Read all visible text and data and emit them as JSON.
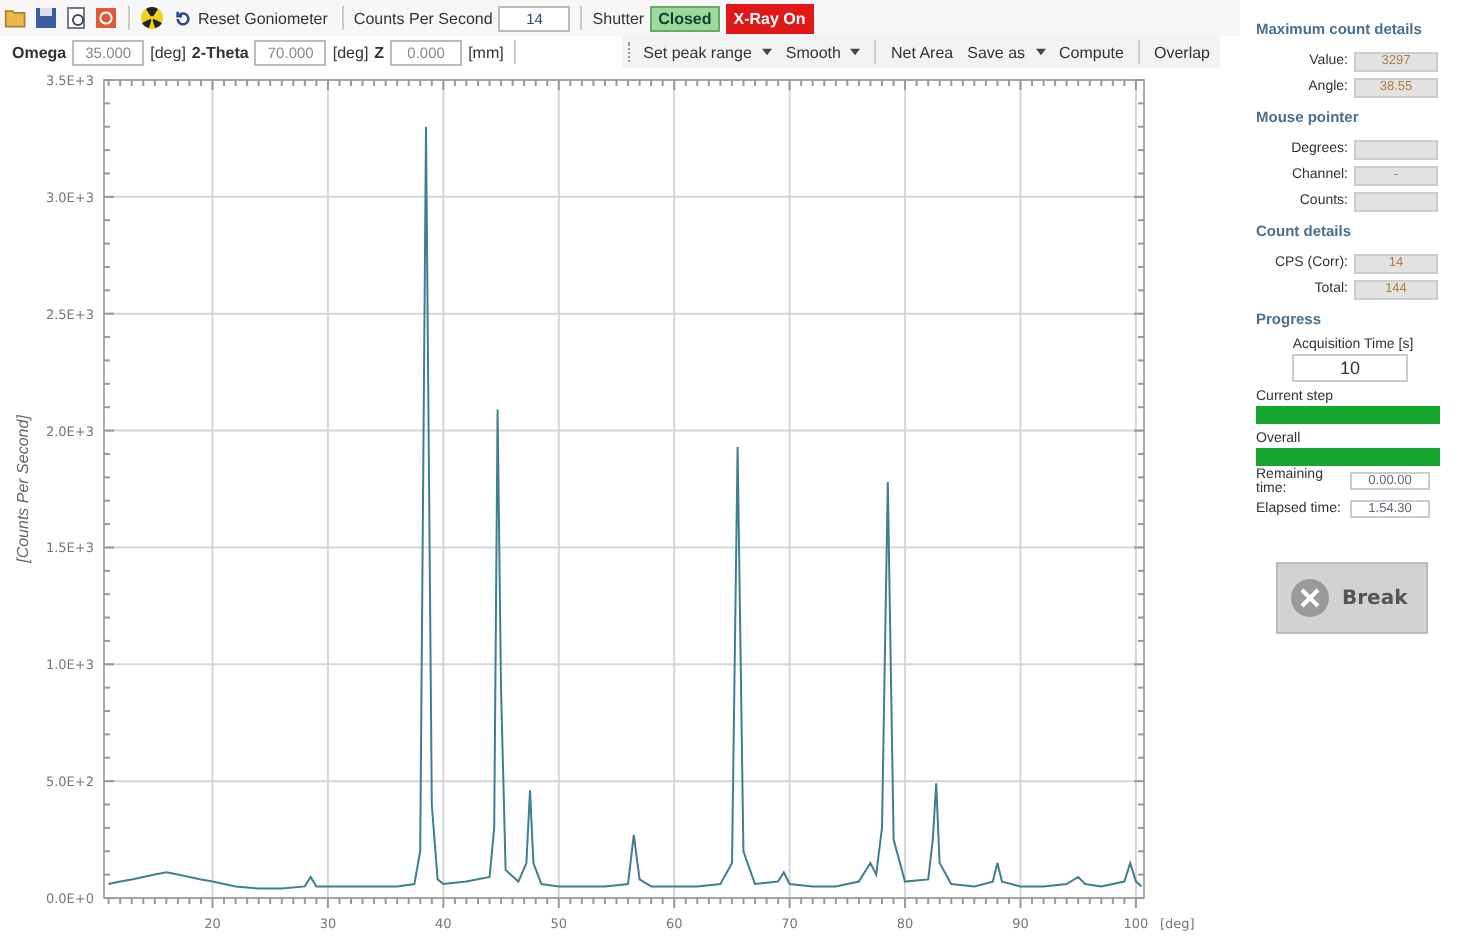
{
  "toolbar": {
    "reset_label": "Reset Goniometer",
    "cps_label": "Counts Per Second",
    "cps_value": "14",
    "shutter_label": "Shutter",
    "shutter_state": "Closed",
    "xray_button": "X-Ray On"
  },
  "position": [
    {
      "label": "Omega",
      "value": "35.000",
      "unit": "[deg]"
    },
    {
      "label": "2-Theta",
      "value": "70.000",
      "unit": "[deg]"
    },
    {
      "label": "Z",
      "value": "0.000",
      "unit": "[mm]"
    }
  ],
  "chart_toolbar": [
    {
      "kind": "dropdown",
      "label": "Set peak range"
    },
    {
      "kind": "dropdown",
      "label": "Smooth"
    },
    {
      "kind": "separator"
    },
    {
      "kind": "button",
      "label": "Net Area"
    },
    {
      "kind": "dropdown",
      "label": "Save as"
    },
    {
      "kind": "button",
      "label": "Compute"
    },
    {
      "kind": "separator"
    },
    {
      "kind": "button",
      "label": "Overlap"
    }
  ],
  "chart": {
    "chart_data": {
      "type": "line",
      "grid": true,
      "xlabel": "[deg]",
      "ylabel": "[Counts Per Second]",
      "xlim": [
        10.6,
        100.7
      ],
      "ylim": [
        0,
        3500
      ],
      "xticks": [
        20,
        30,
        40,
        50,
        60,
        70,
        80,
        90,
        100
      ],
      "yticks": [
        {
          "value": 0,
          "label": "0.0E+0"
        },
        {
          "value": 500,
          "label": "5.0E+2"
        },
        {
          "value": 1000,
          "label": "1.0E+3"
        },
        {
          "value": 1500,
          "label": "1.5E+3"
        },
        {
          "value": 2000,
          "label": "2.0E+3"
        },
        {
          "value": 2500,
          "label": "2.5E+3"
        },
        {
          "value": 3000,
          "label": "3.0E+3"
        },
        {
          "value": 3500,
          "label": "3.5E+3"
        }
      ],
      "x": [
        11,
        12,
        13,
        14,
        15,
        16,
        17,
        18,
        19,
        20,
        22,
        24,
        26,
        28,
        28.5,
        29,
        30,
        32,
        34,
        36,
        37.5,
        38,
        38.5,
        39,
        39.5,
        40,
        42,
        44,
        44.4,
        44.7,
        45,
        45.4,
        46.5,
        47.2,
        47.5,
        47.8,
        48.5,
        50,
        52,
        54,
        56,
        56.5,
        57,
        58,
        60,
        62,
        64,
        65,
        65.5,
        66,
        67,
        69,
        69.5,
        70,
        72,
        74,
        76,
        77,
        77.5,
        78,
        78.5,
        79,
        80,
        82,
        82.4,
        82.7,
        83,
        84,
        86,
        87.6,
        88,
        88.4,
        90,
        92,
        94,
        95,
        95.6,
        97,
        99,
        99.5,
        100,
        100.5
      ],
      "series": [
        {
          "color": "#3f7f8f",
          "values": [
            60,
            70,
            80,
            90,
            100,
            110,
            100,
            90,
            80,
            70,
            50,
            40,
            40,
            50,
            90,
            50,
            50,
            50,
            50,
            50,
            60,
            200,
            3300,
            400,
            80,
            60,
            70,
            90,
            300,
            2090,
            900,
            120,
            70,
            150,
            460,
            150,
            60,
            50,
            50,
            50,
            60,
            270,
            80,
            50,
            50,
            50,
            60,
            150,
            1930,
            200,
            60,
            70,
            110,
            60,
            50,
            50,
            70,
            150,
            100,
            300,
            1780,
            250,
            70,
            80,
            250,
            490,
            150,
            60,
            50,
            70,
            150,
            70,
            50,
            50,
            60,
            90,
            60,
            50,
            70,
            150,
            70,
            50
          ]
        }
      ]
    }
  },
  "max_count": {
    "title": "Maximum count details",
    "fields": [
      {
        "label": "Value:",
        "value": "3297"
      },
      {
        "label": "Angle:",
        "value": "38.55"
      }
    ]
  },
  "mouse_pointer": {
    "title": "Mouse pointer",
    "fields": [
      {
        "label": "Degrees:"
      },
      {
        "label": "Channel:",
        "value": "-"
      },
      {
        "label": "Counts:"
      }
    ]
  },
  "count_details": {
    "title": "Count details",
    "fields": [
      {
        "label": "CPS (Corr):",
        "value": "14"
      },
      {
        "label": "Total:",
        "value": "144"
      }
    ]
  },
  "progress": {
    "title": "Progress",
    "acq_label": "Acquisition Time [s]",
    "acq_value": "10",
    "bars": [
      {
        "label": "Current step",
        "level": 1
      },
      {
        "label": "Overall",
        "level": 1
      }
    ],
    "times": [
      {
        "label": "Remaining time:",
        "value": "0.00.00"
      },
      {
        "label": "Elapsed time:",
        "value": "1.54.30"
      }
    ],
    "break_button": "Break"
  }
}
